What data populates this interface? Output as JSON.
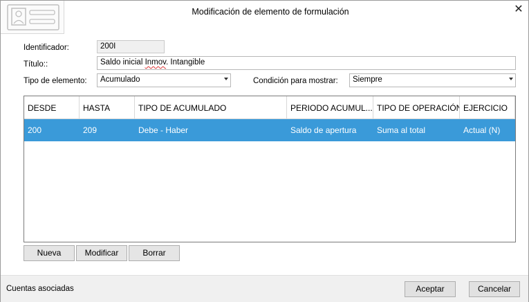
{
  "window": {
    "title": "Modificación de elemento de formulación",
    "close_icon": "close-icon",
    "header_icon": "id-card-icon"
  },
  "form": {
    "id_label": "Identificador:",
    "id_value": "200I",
    "title_label": "Título::",
    "title_value_a": "Saldo inicial ",
    "title_value_b": "Inmov",
    "title_value_c": ". Intangible",
    "type_label": "Tipo de elemento:",
    "type_value": "Acumulado",
    "show_label": "Condición para mostrar:",
    "show_value": "Siempre"
  },
  "grid": {
    "columns": [
      "DESDE",
      "HASTA",
      "TIPO DE ACUMULADO",
      "PERIODO ACUMUL...",
      "TIPO DE OPERACIÓN",
      "EJERCICIO"
    ],
    "rows": [
      [
        "200",
        "209",
        "Debe - Haber",
        "Saldo de apertura",
        "Suma al total",
        "Actual (N)"
      ]
    ],
    "selected_row": 0,
    "selected_color": "#3a9ad9"
  },
  "actions": {
    "new": "Nueva",
    "edit": "Modificar",
    "delete": "Borrar"
  },
  "footer": {
    "label": "Cuentas asociadas",
    "accept": "Aceptar",
    "cancel": "Cancelar"
  }
}
